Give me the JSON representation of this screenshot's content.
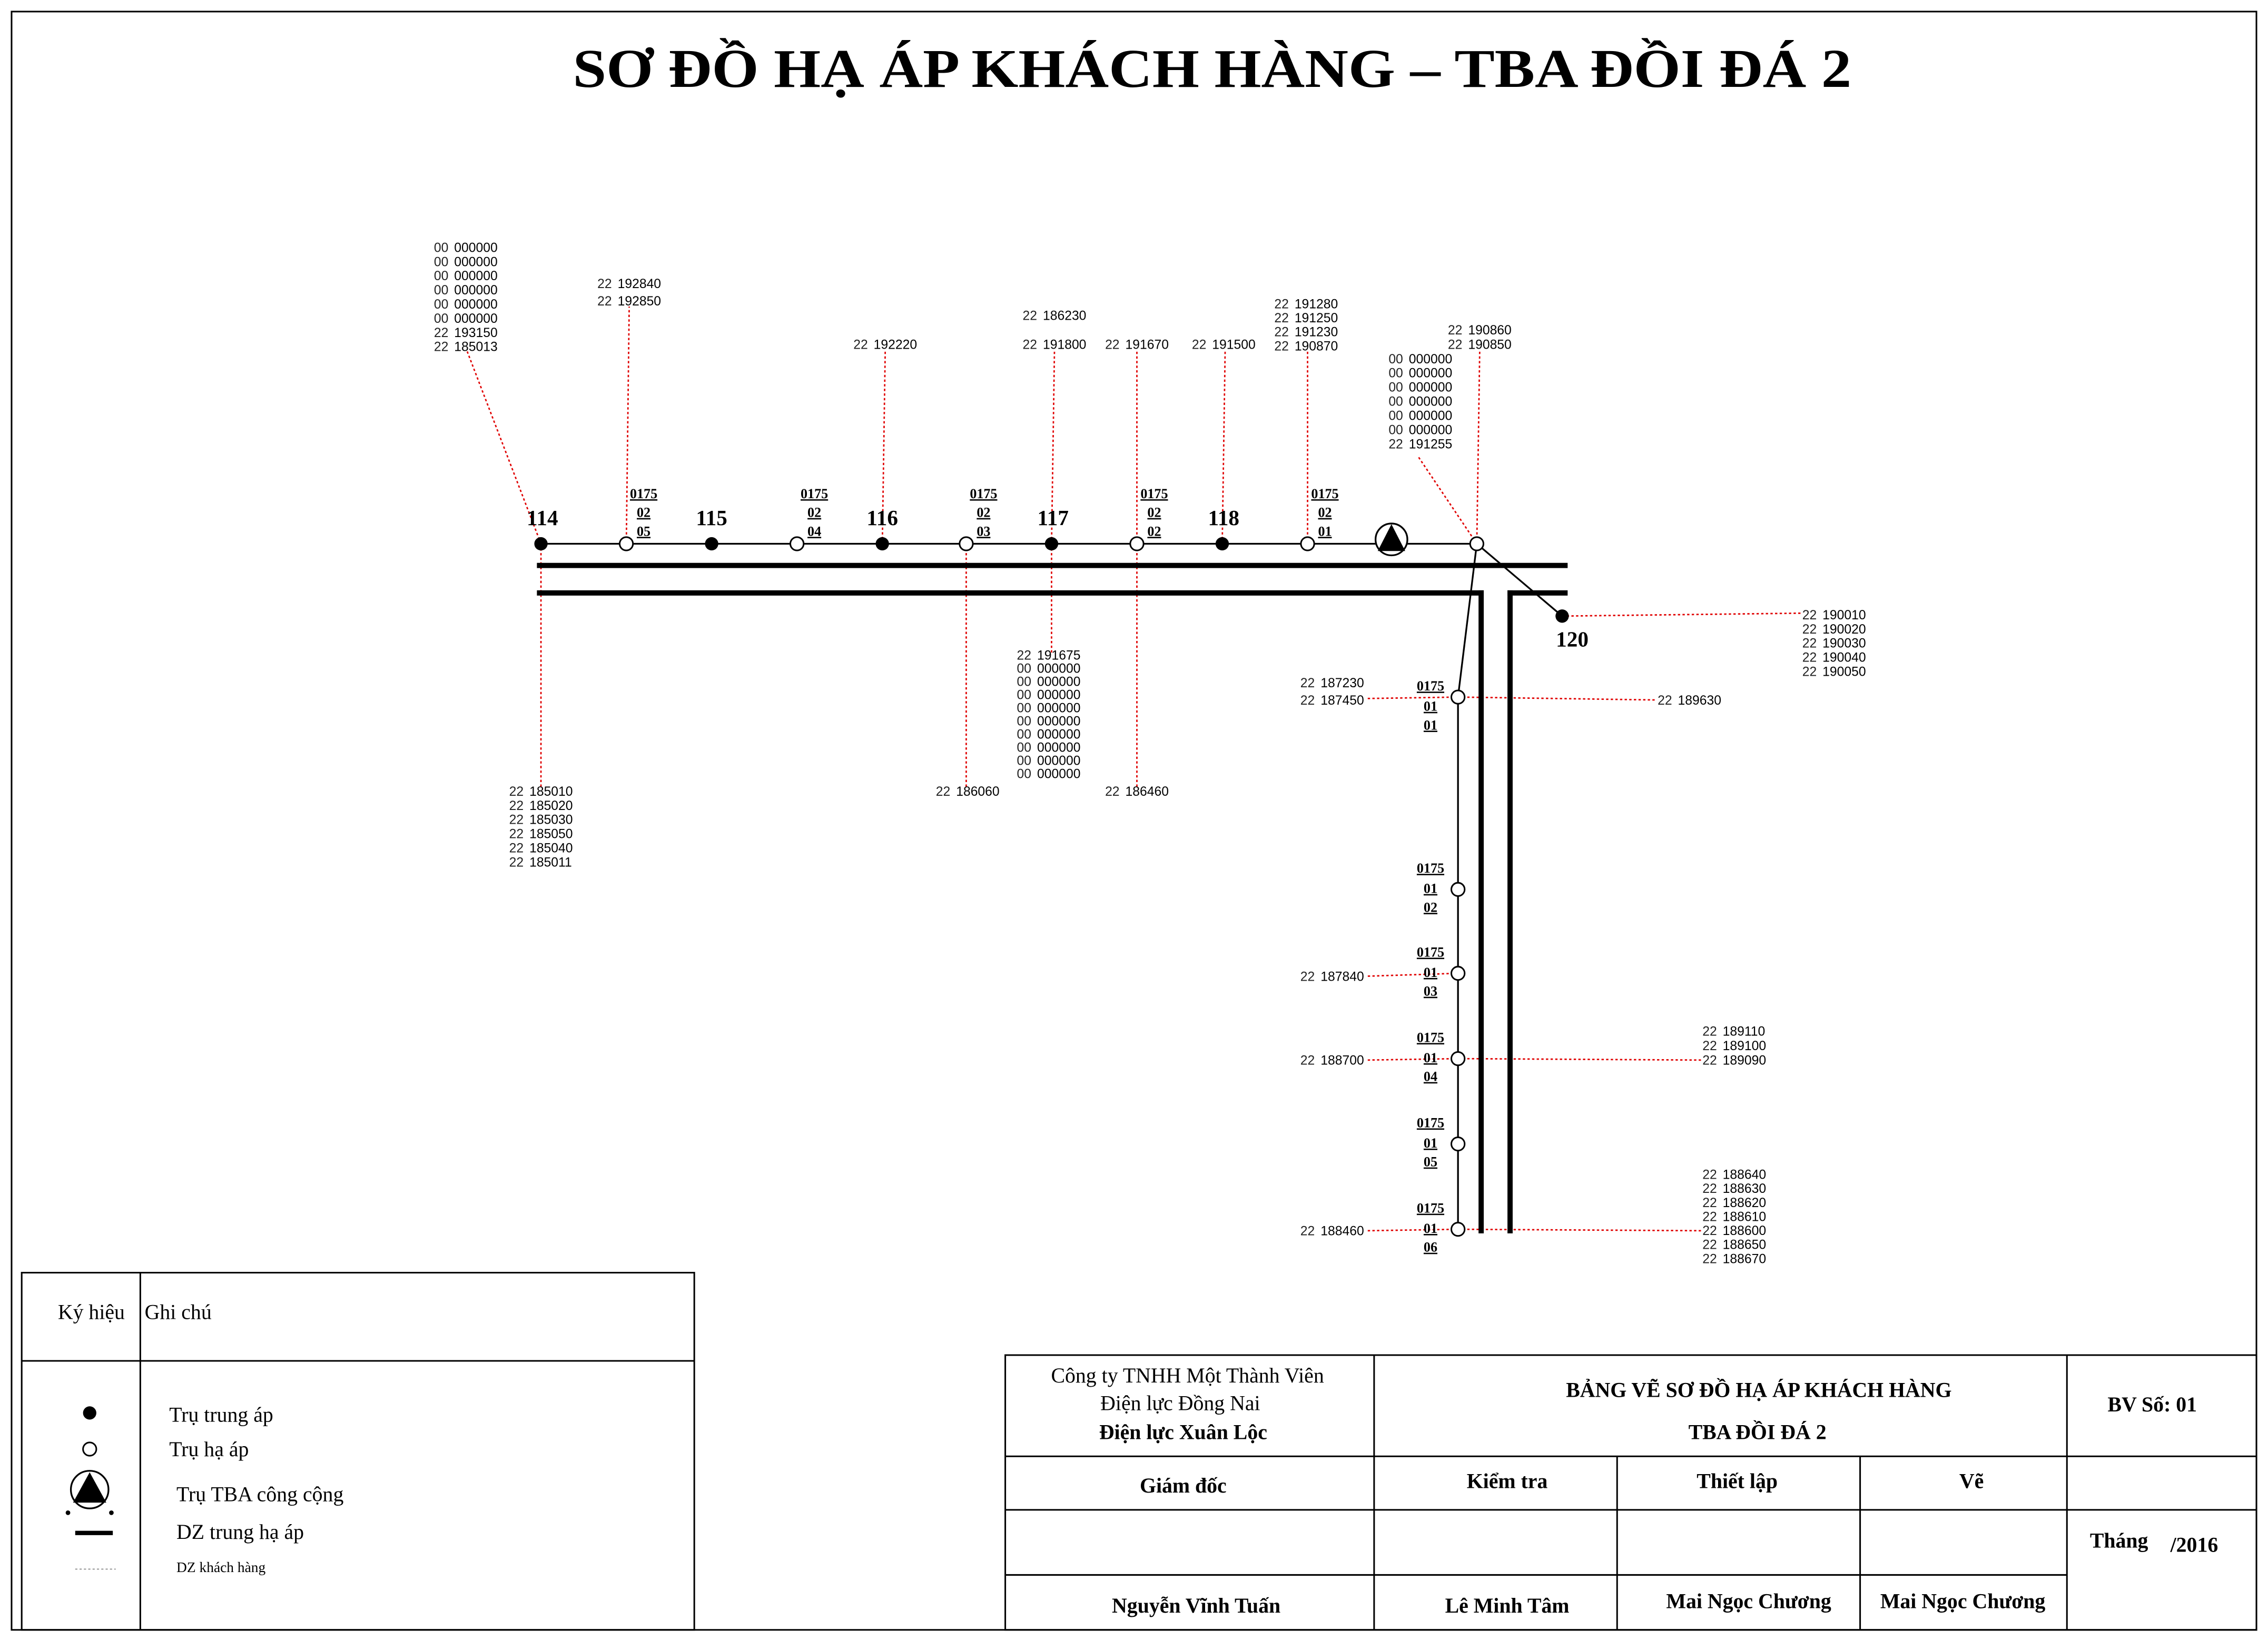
{
  "title": "SƠ ĐỒ HẠ ÁP KHÁCH HÀNG – TBA ĐỒI ĐÁ 2",
  "colors": {
    "network_line": "#000000",
    "customer_line": "#e00000",
    "mv_pole": "#000000",
    "lv_pole_fill": "#ffffff"
  },
  "mv_poles": [
    "114",
    "115",
    "116",
    "117",
    "118",
    "120"
  ],
  "lv_poles_main": [
    {
      "line": "0175",
      "branch": "02",
      "no": "05"
    },
    {
      "line": "0175",
      "branch": "02",
      "no": "04"
    },
    {
      "line": "0175",
      "branch": "02",
      "no": "03"
    },
    {
      "line": "0175",
      "branch": "02",
      "no": "02"
    },
    {
      "line": "0175",
      "branch": "02",
      "no": "01"
    }
  ],
  "lv_poles_branch": [
    {
      "line": "0175",
      "branch": "01",
      "no": "01"
    },
    {
      "line": "0175",
      "branch": "01",
      "no": "02"
    },
    {
      "line": "0175",
      "branch": "01",
      "no": "03"
    },
    {
      "line": "0175",
      "branch": "01",
      "no": "04"
    },
    {
      "line": "0175",
      "branch": "01",
      "no": "05"
    },
    {
      "line": "0175",
      "branch": "01",
      "no": "06"
    }
  ],
  "customers": {
    "pole_114_up": [
      "00 000000",
      "00 000000",
      "00 000000",
      "00 000000",
      "00 000000",
      "00 000000",
      "22 193150",
      "22 185013"
    ],
    "pole_114_down": [
      "22 185010",
      "22 185020",
      "22 185030",
      "22 185050",
      "22 185040",
      "22 185011"
    ],
    "lv_02_05_up": [
      "22 192840",
      "22 192850"
    ],
    "pole_116_up": [
      "22 192220"
    ],
    "lv_02_03_down": [
      "22 186060"
    ],
    "pole_117_up": [
      "22 186230",
      "22 191800"
    ],
    "pole_117_down": [
      "22 191675",
      "00 000000",
      "00 000000",
      "00 000000",
      "00 000000",
      "00 000000",
      "00 000000",
      "00 000000",
      "00 000000",
      "00 000000"
    ],
    "lv_02_02_up": [
      "22 191670"
    ],
    "lv_02_02_down": [
      "22 186460"
    ],
    "pole_118_up": [
      "22 191500"
    ],
    "lv_02_01_up": [
      "22 191280",
      "22 191250",
      "22 191230",
      "22 190870"
    ],
    "junction_upleft": [
      "00 000000",
      "00 000000",
      "00 000000",
      "00 000000",
      "00 000000",
      "00 000000",
      "22 191255"
    ],
    "junction_up": [
      "22 190860",
      "22 190850"
    ],
    "pole_120_right": [
      "22 190010",
      "22 190020",
      "22 190030",
      "22 190040",
      "22 190050"
    ],
    "lv_01_01_left": [
      "22 187230",
      "22 187450"
    ],
    "lv_01_01_right": [
      "22 189630"
    ],
    "lv_01_03_left": [
      "22 187840"
    ],
    "lv_01_04_left": [
      "22 188700"
    ],
    "lv_01_04_right": [
      "22 189110",
      "22 189100",
      "22 189090"
    ],
    "lv_01_06_left": [
      "22 188460"
    ],
    "lv_01_06_right": [
      "22 188640",
      "22 188630",
      "22 188620",
      "22 188610",
      "22 188600",
      "22 188650",
      "22 188670"
    ]
  },
  "legend": {
    "header_symbol": "Ký hiệu",
    "header_note": "Ghi chú",
    "items": [
      {
        "icon": "mv-pole-icon",
        "label": "Trụ trung áp"
      },
      {
        "icon": "lv-pole-icon",
        "label": "Trụ hạ áp"
      },
      {
        "icon": "substation-icon",
        "label": "Trụ TBA công cộng"
      },
      {
        "icon": "mv-lv-line-icon",
        "label": "DZ trung hạ áp"
      },
      {
        "icon": "customer-line-icon",
        "label": "DZ khách hàng"
      }
    ]
  },
  "title_block": {
    "company_line1": "Công ty TNHH Một Thành Viên",
    "company_line2": "Điện lực Đồng Nai",
    "company_line3": "Điện lực Xuân Lộc",
    "drawing_title": "BẢNG VẼ SƠ ĐỒ HẠ ÁP KHÁCH HÀNG",
    "drawing_subtitle": "TBA ĐỒI ĐÁ 2",
    "sheet_no": "BV Số: 01",
    "roles": [
      "Giám đốc",
      "Kiểm tra",
      "Thiết lập",
      "Vẽ"
    ],
    "names": [
      "Nguyễn Vĩnh Tuấn",
      "Lê Minh Tâm",
      "Mai Ngọc Chương",
      "Mai Ngọc Chương"
    ],
    "month_label": "Tháng",
    "year": "/2016"
  }
}
